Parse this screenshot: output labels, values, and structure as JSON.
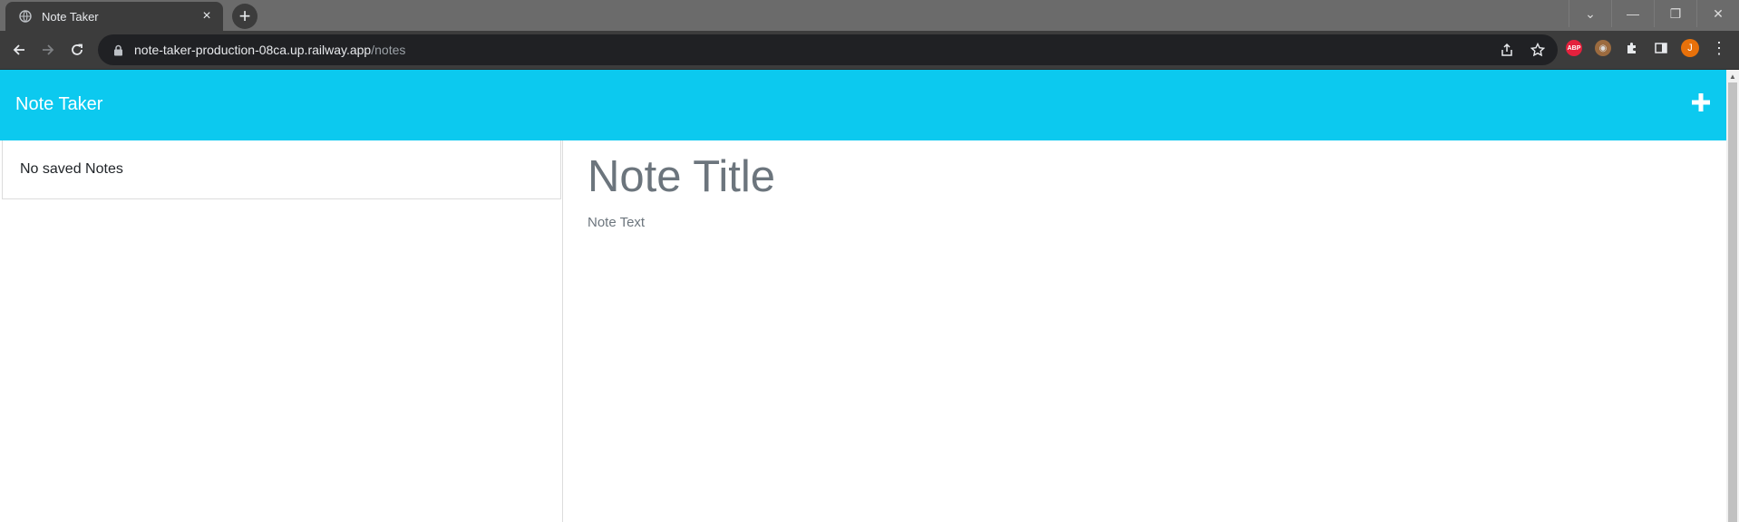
{
  "browser": {
    "tab_title": "Note Taker",
    "tab_close": "×",
    "new_tab": "+",
    "url_host": "note-taker-production-08ca.up.railway.app",
    "url_path": "/notes",
    "extensions": {
      "abp_label": "ABP",
      "profile_initial": "J"
    },
    "menu_glyph": "⋮",
    "window_controls": {
      "dropdown": "⌄",
      "minimize": "—",
      "restore": "❐",
      "close": "✕"
    }
  },
  "app": {
    "brand": "Note Taker",
    "accent_color": "#0cc9ef"
  },
  "sidebar": {
    "items": [
      {
        "label": "No saved Notes"
      }
    ]
  },
  "editor": {
    "title_placeholder": "Note Title",
    "text_placeholder": "Note Text"
  },
  "icons": {
    "tab": "globe-icon",
    "back": "arrow-left-icon",
    "forward": "arrow-right-icon",
    "reload": "reload-icon",
    "lock": "lock-icon",
    "share": "share-icon",
    "bookmark": "star-icon",
    "extensions": "puzzle-icon",
    "side_panel": "side-panel-icon",
    "new_note": "plus-icon"
  }
}
